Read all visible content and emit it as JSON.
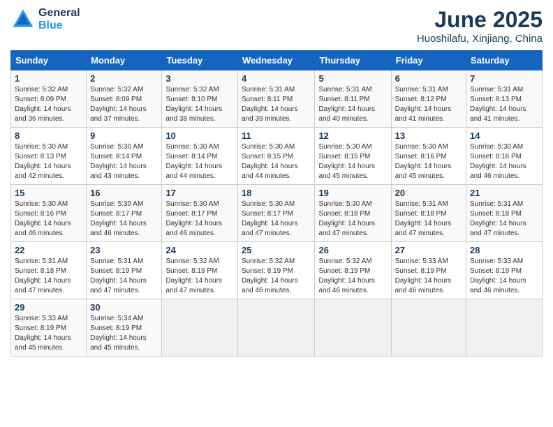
{
  "header": {
    "logo_line1": "General",
    "logo_line2": "Blue",
    "month": "June 2025",
    "location": "Huoshilafu, Xinjiang, China"
  },
  "weekdays": [
    "Sunday",
    "Monday",
    "Tuesday",
    "Wednesday",
    "Thursday",
    "Friday",
    "Saturday"
  ],
  "weeks": [
    [
      {
        "day": "1",
        "info": "Sunrise: 5:32 AM\nSunset: 8:09 PM\nDaylight: 14 hours\nand 36 minutes."
      },
      {
        "day": "2",
        "info": "Sunrise: 5:32 AM\nSunset: 8:09 PM\nDaylight: 14 hours\nand 37 minutes."
      },
      {
        "day": "3",
        "info": "Sunrise: 5:32 AM\nSunset: 8:10 PM\nDaylight: 14 hours\nand 38 minutes."
      },
      {
        "day": "4",
        "info": "Sunrise: 5:31 AM\nSunset: 8:11 PM\nDaylight: 14 hours\nand 39 minutes."
      },
      {
        "day": "5",
        "info": "Sunrise: 5:31 AM\nSunset: 8:11 PM\nDaylight: 14 hours\nand 40 minutes."
      },
      {
        "day": "6",
        "info": "Sunrise: 5:31 AM\nSunset: 8:12 PM\nDaylight: 14 hours\nand 41 minutes."
      },
      {
        "day": "7",
        "info": "Sunrise: 5:31 AM\nSunset: 8:13 PM\nDaylight: 14 hours\nand 41 minutes."
      }
    ],
    [
      {
        "day": "8",
        "info": "Sunrise: 5:30 AM\nSunset: 8:13 PM\nDaylight: 14 hours\nand 42 minutes."
      },
      {
        "day": "9",
        "info": "Sunrise: 5:30 AM\nSunset: 8:14 PM\nDaylight: 14 hours\nand 43 minutes."
      },
      {
        "day": "10",
        "info": "Sunrise: 5:30 AM\nSunset: 8:14 PM\nDaylight: 14 hours\nand 44 minutes."
      },
      {
        "day": "11",
        "info": "Sunrise: 5:30 AM\nSunset: 8:15 PM\nDaylight: 14 hours\nand 44 minutes."
      },
      {
        "day": "12",
        "info": "Sunrise: 5:30 AM\nSunset: 8:15 PM\nDaylight: 14 hours\nand 45 minutes."
      },
      {
        "day": "13",
        "info": "Sunrise: 5:30 AM\nSunset: 8:16 PM\nDaylight: 14 hours\nand 45 minutes."
      },
      {
        "day": "14",
        "info": "Sunrise: 5:30 AM\nSunset: 8:16 PM\nDaylight: 14 hours\nand 46 minutes."
      }
    ],
    [
      {
        "day": "15",
        "info": "Sunrise: 5:30 AM\nSunset: 8:16 PM\nDaylight: 14 hours\nand 46 minutes."
      },
      {
        "day": "16",
        "info": "Sunrise: 5:30 AM\nSunset: 8:17 PM\nDaylight: 14 hours\nand 46 minutes."
      },
      {
        "day": "17",
        "info": "Sunrise: 5:30 AM\nSunset: 8:17 PM\nDaylight: 14 hours\nand 46 minutes."
      },
      {
        "day": "18",
        "info": "Sunrise: 5:30 AM\nSunset: 8:17 PM\nDaylight: 14 hours\nand 47 minutes."
      },
      {
        "day": "19",
        "info": "Sunrise: 5:30 AM\nSunset: 8:18 PM\nDaylight: 14 hours\nand 47 minutes."
      },
      {
        "day": "20",
        "info": "Sunrise: 5:31 AM\nSunset: 8:18 PM\nDaylight: 14 hours\nand 47 minutes."
      },
      {
        "day": "21",
        "info": "Sunrise: 5:31 AM\nSunset: 8:18 PM\nDaylight: 14 hours\nand 47 minutes."
      }
    ],
    [
      {
        "day": "22",
        "info": "Sunrise: 5:31 AM\nSunset: 8:18 PM\nDaylight: 14 hours\nand 47 minutes."
      },
      {
        "day": "23",
        "info": "Sunrise: 5:31 AM\nSunset: 8:19 PM\nDaylight: 14 hours\nand 47 minutes."
      },
      {
        "day": "24",
        "info": "Sunrise: 5:32 AM\nSunset: 8:19 PM\nDaylight: 14 hours\nand 47 minutes."
      },
      {
        "day": "25",
        "info": "Sunrise: 5:32 AM\nSunset: 8:19 PM\nDaylight: 14 hours\nand 46 minutes."
      },
      {
        "day": "26",
        "info": "Sunrise: 5:32 AM\nSunset: 8:19 PM\nDaylight: 14 hours\nand 46 minutes."
      },
      {
        "day": "27",
        "info": "Sunrise: 5:33 AM\nSunset: 8:19 PM\nDaylight: 14 hours\nand 46 minutes."
      },
      {
        "day": "28",
        "info": "Sunrise: 5:33 AM\nSunset: 8:19 PM\nDaylight: 14 hours\nand 46 minutes."
      }
    ],
    [
      {
        "day": "29",
        "info": "Sunrise: 5:33 AM\nSunset: 8:19 PM\nDaylight: 14 hours\nand 45 minutes."
      },
      {
        "day": "30",
        "info": "Sunrise: 5:34 AM\nSunset: 8:19 PM\nDaylight: 14 hours\nand 45 minutes."
      },
      {
        "day": "",
        "info": ""
      },
      {
        "day": "",
        "info": ""
      },
      {
        "day": "",
        "info": ""
      },
      {
        "day": "",
        "info": ""
      },
      {
        "day": "",
        "info": ""
      }
    ]
  ]
}
